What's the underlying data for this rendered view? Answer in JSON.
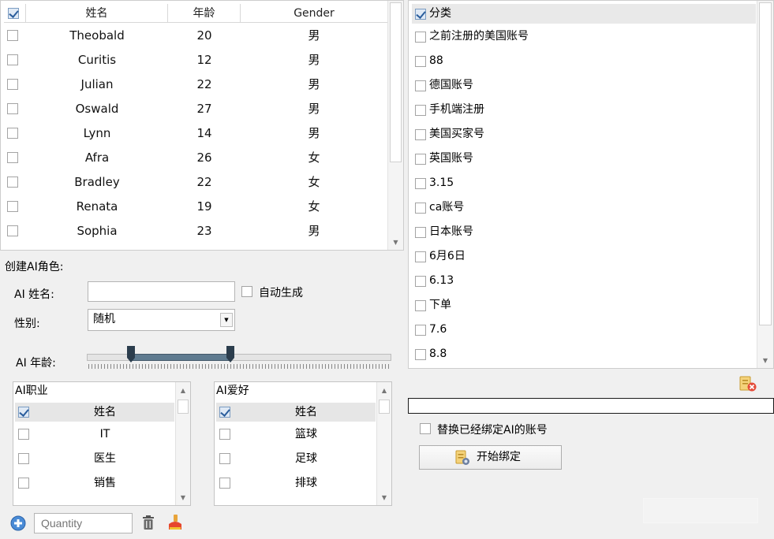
{
  "person_table": {
    "columns": [
      "姓名",
      "年龄",
      "Gender"
    ],
    "rows": [
      {
        "name": "Theobald",
        "age": "20",
        "gender": "男"
      },
      {
        "name": "Curitis",
        "age": "12",
        "gender": "男"
      },
      {
        "name": "Julian",
        "age": "22",
        "gender": "男"
      },
      {
        "name": "Oswald",
        "age": "27",
        "gender": "男"
      },
      {
        "name": "Lynn",
        "age": "14",
        "gender": "男"
      },
      {
        "name": "Afra",
        "age": "26",
        "gender": "女"
      },
      {
        "name": "Bradley",
        "age": "22",
        "gender": "女"
      },
      {
        "name": "Renata",
        "age": "19",
        "gender": "女"
      },
      {
        "name": "Sophia",
        "age": "23",
        "gender": "男"
      }
    ]
  },
  "create_ai": {
    "title": "创建AI角色:",
    "name_label": "AI 姓名:",
    "name_value": "",
    "auto_generate_label": "自动生成",
    "gender_label": "性别:",
    "gender_value": "随机",
    "age_label": "AI 年龄:"
  },
  "job_list": {
    "title": "AI职业",
    "column": "姓名",
    "items": [
      "IT",
      "医生",
      "销售"
    ]
  },
  "hobby_list": {
    "title": "AI爱好",
    "column": "姓名",
    "items": [
      "篮球",
      "足球",
      "排球"
    ]
  },
  "bottom_toolbar": {
    "quantity_placeholder": "Quantity",
    "add_icon": "plus-circle-icon",
    "delete_icon": "trash-icon",
    "clear_icon": "eraser-icon"
  },
  "category_list": {
    "header": "分类",
    "items": [
      "之前注册的美国账号",
      "88",
      "德国账号",
      "手机端注册",
      "美国买家号",
      "英国账号",
      "3.15",
      "ca账号",
      "日本账号",
      "6月6日",
      "6.13",
      "下单",
      "7.6",
      "8.8"
    ]
  },
  "binding": {
    "replace_label": "替换已经绑定AI的账号",
    "start_button": "开始绑定",
    "progress_value": 0
  },
  "colors": {
    "accent": "#2a5d9c",
    "slider_range": "#5f7b90",
    "slider_handle": "#2b3d4d"
  }
}
